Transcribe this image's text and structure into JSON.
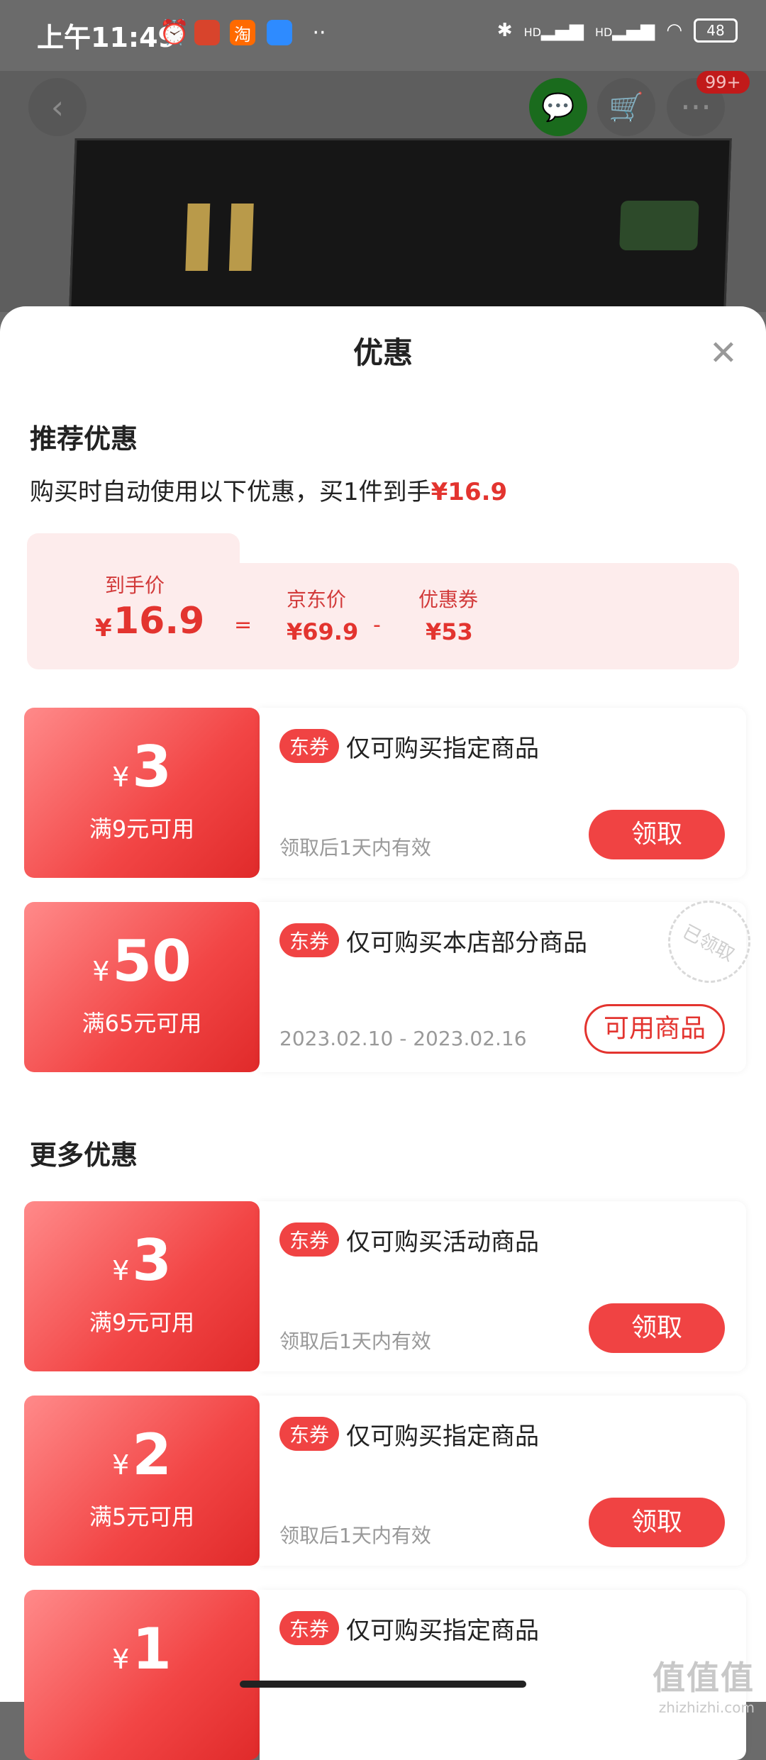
{
  "status_bar": {
    "time": "上午11:49",
    "battery": "48",
    "hd1": "HD",
    "hd2": "HD"
  },
  "top_nav": {
    "more_badge": "99+"
  },
  "sheet": {
    "title": "优惠",
    "recommend_section": "推荐优惠",
    "description_prefix": "购买时自动使用以下优惠，买1件到手",
    "description_price": "¥16.9",
    "summary": {
      "final_label": "到手价",
      "final_yen": "¥",
      "final_value": "16.9",
      "equals": "=",
      "jd_label": "京东价",
      "jd_value": "¥69.9",
      "minus": "-",
      "coupon_label": "优惠券",
      "coupon_value": "¥53"
    },
    "more_section": "更多优惠"
  },
  "coupons": [
    {
      "yen": "¥",
      "amount": "3",
      "condition": "满9元可用",
      "tag": "东券",
      "desc": "仅可购买指定商品",
      "validity": "领取后1天内有效",
      "button": "领取"
    },
    {
      "yen": "¥",
      "amount": "50",
      "condition": "满65元可用",
      "tag": "东券",
      "desc": "仅可购买本店部分商品",
      "validity": "2023.02.10 - 2023.02.16",
      "button": "可用商品",
      "stamp": "已领取"
    },
    {
      "yen": "¥",
      "amount": "3",
      "condition": "满9元可用",
      "tag": "东券",
      "desc": "仅可购买活动商品",
      "validity": "领取后1天内有效",
      "button": "领取"
    },
    {
      "yen": "¥",
      "amount": "2",
      "condition": "满5元可用",
      "tag": "东券",
      "desc": "仅可购买指定商品",
      "validity": "领取后1天内有效",
      "button": "领取"
    },
    {
      "yen": "¥",
      "amount": "1",
      "condition": "",
      "tag": "东券",
      "desc": "仅可购买指定商品",
      "validity": "",
      "button": ""
    }
  ],
  "watermark": {
    "main": "值值值",
    "sub": "zhizhizhi.com"
  },
  "colors": {
    "accent": "#e3342f",
    "coupon_bg": "#f24545",
    "summary_bg": "#fdecec"
  }
}
